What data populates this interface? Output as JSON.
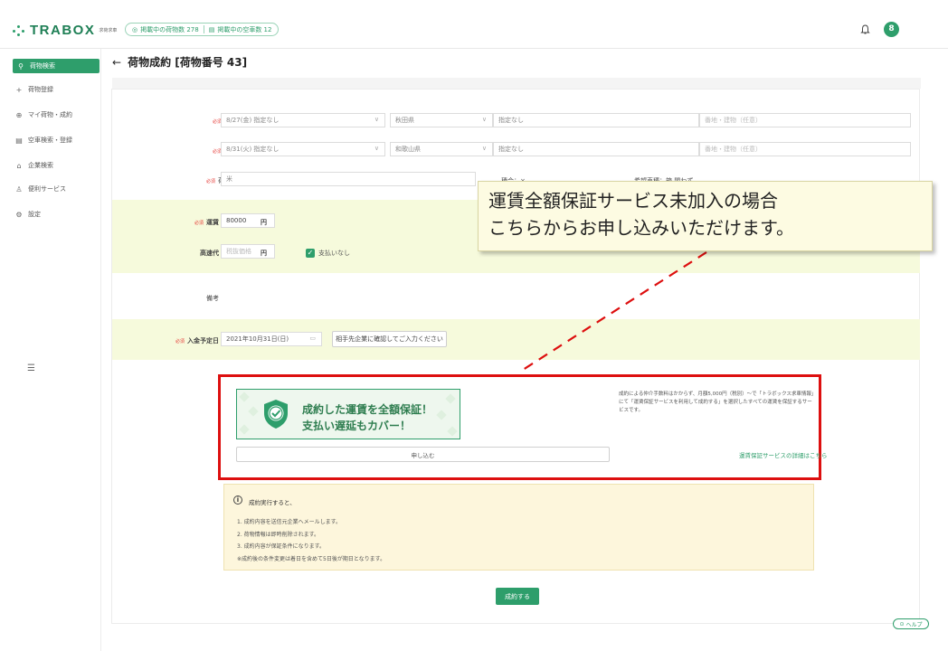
{
  "header": {
    "logo_text": "TRABOX",
    "logo_sub": "求荷求車",
    "chips": [
      {
        "icon": "box-icon",
        "label": "掲載中の荷物数 278"
      },
      {
        "icon": "truck-icon",
        "label": "掲載中の空車数 12"
      }
    ],
    "avatar_initial": "8"
  },
  "sidebar": {
    "items": [
      {
        "icon": "search-icon",
        "label": "荷物検索",
        "active": true
      },
      {
        "icon": "plus-icon",
        "label": "荷物登録"
      },
      {
        "icon": "box-icon",
        "label": "マイ荷物・成約"
      },
      {
        "icon": "truck-icon",
        "label": "空車検索・登録"
      },
      {
        "icon": "building-icon",
        "label": "企業検索"
      },
      {
        "icon": "people-icon",
        "label": "便利サービス"
      },
      {
        "icon": "gear-icon",
        "label": "設定"
      }
    ]
  },
  "page": {
    "title": "荷物成約 [荷物番号 43]"
  },
  "form": {
    "required_mark": "必須",
    "departure": {
      "label": "発",
      "date": "8/27(金) 指定なし",
      "prefecture": "秋田県",
      "city": "指定なし",
      "address_placeholder": "番地・建物（任意）"
    },
    "arrival": {
      "label": "着",
      "date": "8/31(火) 指定なし",
      "prefecture": "和歌山県",
      "city": "指定なし",
      "address_placeholder": "番地・建物（任意）"
    },
    "cargo": {
      "label": "荷種",
      "value": "米",
      "mixed": "積合：×",
      "vehicle": "希望車種：箱 問わず"
    },
    "fare": {
      "label": "運賃",
      "value": "80000",
      "unit": "円"
    },
    "toll": {
      "label": "高速代",
      "placeholder": "税抜価格",
      "unit": "円",
      "checkbox_label": "支払いなし"
    },
    "remarks": {
      "label": "備考"
    },
    "payment_date": {
      "label": "入金予定日",
      "value": "2021年10月31日(日)",
      "confirm_button": "相手先企業に確認してご入力ください"
    }
  },
  "callout": {
    "line1": "運賃全額保証サービス未加入の場合",
    "line2": "こちらからお申し込みいただけます。"
  },
  "guarantee": {
    "banner_line1": "成約した運賃を全額保証！",
    "banner_line2": "支払い遅延もカバー！",
    "description": "成約による仲介手数料はかからず、月額5,000円（税別）～で「トラボックス求車情報」にて「運賃保証サービスを利用して成約する」を選択したすべての運賃を保証するサービスです。",
    "apply_button": "申し込む",
    "details_link": "運賃保証サービスの詳細はこちら"
  },
  "notice": {
    "title": "成約実行すると、",
    "lines": [
      "1. 成約内容を送信元企業へメールします。",
      "2. 荷物情報は即時削除されます。",
      "3. 成約内容が保証条件になります。",
      "※成約後の条件変更は着日を含めて5日後が期日となります。"
    ]
  },
  "actions": {
    "submit": "成約する",
    "help": "ヘルプ"
  },
  "colors": {
    "brand": "#2e9e6b",
    "highlight_band": "#f6fadc",
    "annotation_red": "#dd0f0f"
  }
}
